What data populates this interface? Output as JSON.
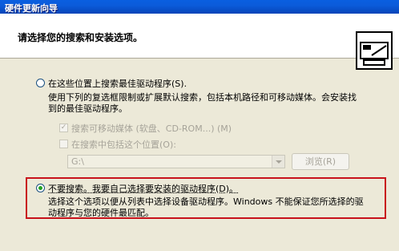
{
  "window": {
    "title": "硬件更新向导"
  },
  "header": {
    "title": "请选择您的搜索和安装选项。"
  },
  "options": {
    "search": {
      "label": "在这些位置上搜索最佳驱动程序",
      "accelerator": "(S).",
      "selected": false,
      "description_line1": "使用下列的复选框限制或扩展默认搜索，包括本机路径和可移动媒体。会安装找",
      "description_line2": "到的最佳驱动程序。",
      "removable_media": {
        "label": "搜索可移动媒体 (软盘、CD-ROM...) (M)",
        "checked": true,
        "enabled": false
      },
      "include_location": {
        "label": "在搜索中包括这个位置(O):",
        "checked": false,
        "enabled": false
      },
      "path_value": "G:\\",
      "browse_label": "浏览(R)"
    },
    "manual": {
      "label": "不要搜索。我要自己选择要安装的驱动程序(D)。",
      "selected": true,
      "description_line1": "选择这个选项以便从列表中选择设备驱动程序。Windows 不能保证您所选择的驱",
      "description_line2": "动程序与您的硬件最匹配。"
    }
  },
  "colors": {
    "titlebar": "#0A5FE0",
    "window_bg": "#ECE9D8",
    "highlight": "#C8121B",
    "radio_dot": "#21A121"
  }
}
